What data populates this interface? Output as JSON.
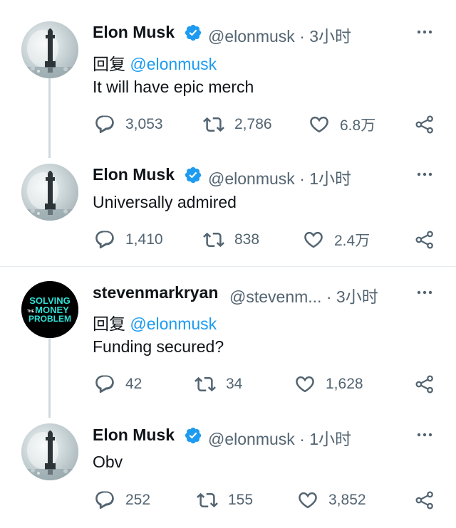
{
  "tweets": [
    {
      "name": "Elon Musk",
      "handle": "@elonmusk",
      "separator": "·",
      "time": "3小时",
      "reply_label": "回复",
      "reply_mention": "@elonmusk",
      "text": "It will have epic merch",
      "replies": "3,053",
      "retweets": "2,786",
      "likes": "6.8万"
    },
    {
      "name": "Elon Musk",
      "handle": "@elonmusk",
      "separator": "·",
      "time": "1小时",
      "text": "Universally admired",
      "replies": "1,410",
      "retweets": "838",
      "likes": "2.4万"
    },
    {
      "name": "stevenmarkryan",
      "handle": "@stevenm...",
      "separator": "·",
      "time": "3小时",
      "reply_label": "回复",
      "reply_mention": "@elonmusk",
      "text": "Funding secured?",
      "replies": "42",
      "retweets": "34",
      "likes": "1,628",
      "avatar_text": [
        "SOLVING",
        "MONEY",
        "PROBLEM"
      ],
      "avatar_small_text": "THE"
    },
    {
      "name": "Elon Musk",
      "handle": "@elonmusk",
      "separator": "·",
      "time": "1小时",
      "text": "Obv",
      "replies": "252",
      "retweets": "155",
      "likes": "3,852"
    }
  ],
  "colors": {
    "verified": "#1d9bf0",
    "mention": "#1d9bf0",
    "meta": "#536471",
    "avatar_text": "#2fe0d6"
  }
}
